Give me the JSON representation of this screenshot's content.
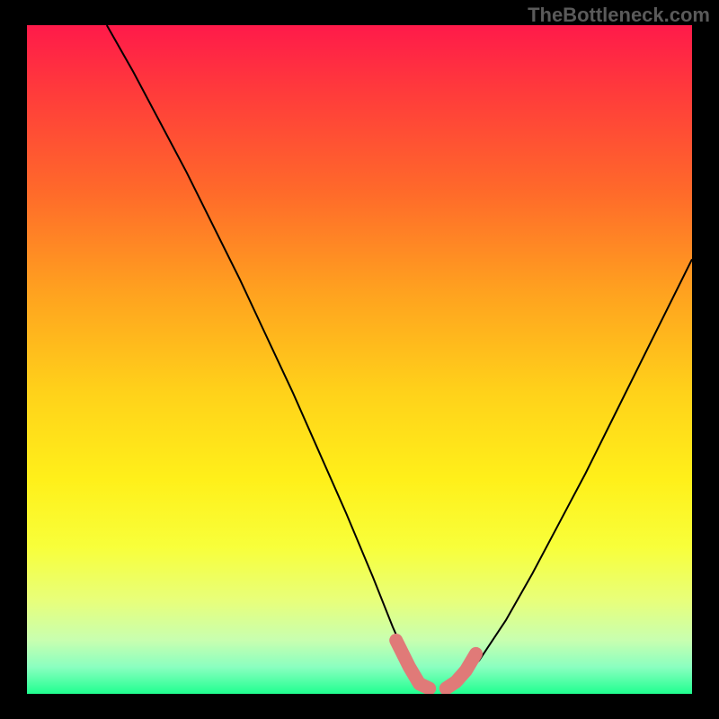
{
  "watermark": "TheBottleneck.com",
  "chart_data": {
    "type": "line",
    "title": "",
    "xlabel": "",
    "ylabel": "",
    "xlim": [
      0,
      100
    ],
    "ylim": [
      0,
      100
    ],
    "series": [
      {
        "name": "left-curve",
        "x": [
          12,
          16,
          20,
          24,
          28,
          32,
          36,
          40,
          44,
          48,
          52,
          55,
          57,
          59,
          60.5
        ],
        "y": [
          100,
          93,
          85.5,
          78,
          70,
          62,
          53.5,
          45,
          36,
          27,
          17.5,
          10,
          5.5,
          2,
          0.5
        ]
      },
      {
        "name": "right-curve",
        "x": [
          63,
          65,
          68,
          72,
          76,
          80,
          84,
          88,
          92,
          96,
          100
        ],
        "y": [
          0.5,
          2,
          5,
          11,
          18,
          25.5,
          33,
          41,
          49,
          57,
          65
        ]
      },
      {
        "name": "left-marker-band",
        "x": [
          55.5,
          57.5,
          59,
          60.5
        ],
        "y": [
          8,
          4,
          1.5,
          0.8
        ]
      },
      {
        "name": "right-marker-band",
        "x": [
          63,
          64.5,
          66,
          67.5
        ],
        "y": [
          0.8,
          1.8,
          3.5,
          6
        ]
      }
    ],
    "colors": {
      "curve": "#000000",
      "marker": "#e07a78"
    }
  }
}
